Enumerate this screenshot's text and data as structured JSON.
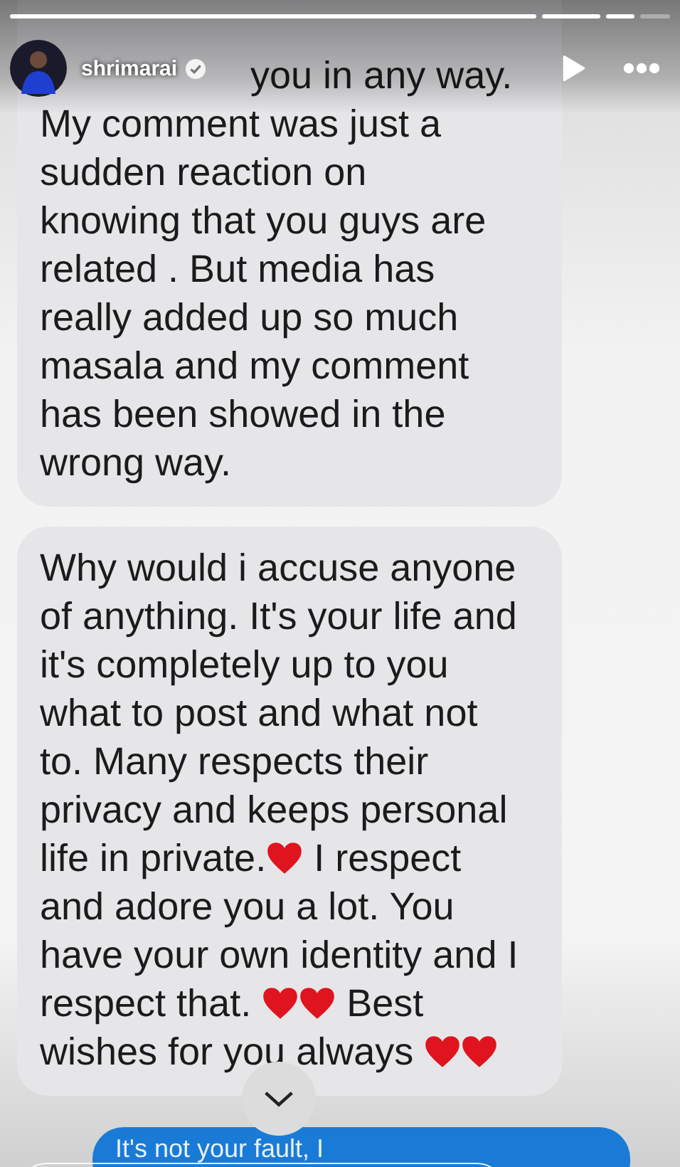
{
  "story_progress": [
    {
      "level": 1
    },
    {
      "level": 1
    },
    {
      "level": 1
    },
    {
      "level": 0
    }
  ],
  "header": {
    "username": "shrimarai",
    "verified": true
  },
  "messages": [
    {
      "kind": "received",
      "top_cut": true,
      "lines": [
        [
          {
            "kind": "text",
            "text": "you in any way."
          }
        ],
        [
          {
            "kind": "text",
            "text": "My comment was just a"
          }
        ],
        [
          {
            "kind": "text",
            "text": "sudden reaction on"
          }
        ],
        [
          {
            "kind": "text",
            "text": "knowing that you guys are"
          }
        ],
        [
          {
            "kind": "text",
            "text": "related . But media has"
          }
        ],
        [
          {
            "kind": "text",
            "text": "really added up so much"
          }
        ],
        [
          {
            "kind": "text",
            "text": "masala and my comment"
          }
        ],
        [
          {
            "kind": "text",
            "text": "has been showed in the"
          }
        ],
        [
          {
            "kind": "text",
            "text": "wrong way."
          }
        ]
      ]
    },
    {
      "kind": "received",
      "lines": [
        [
          {
            "kind": "text",
            "text": "Why would i accuse anyone"
          }
        ],
        [
          {
            "kind": "text",
            "text": "of anything. It's your life and"
          }
        ],
        [
          {
            "kind": "text",
            "text": "it's completely up to you"
          }
        ],
        [
          {
            "kind": "text",
            "text": "what to post and what not"
          }
        ],
        [
          {
            "kind": "text",
            "text": "to. Many respects their"
          }
        ],
        [
          {
            "kind": "text",
            "text": "privacy and keeps personal"
          }
        ],
        [
          {
            "kind": "text",
            "text": "life in private."
          },
          {
            "kind": "heart"
          },
          {
            "kind": "text",
            "text": " I respect"
          }
        ],
        [
          {
            "kind": "text",
            "text": "and adore you a lot. You"
          }
        ],
        [
          {
            "kind": "text",
            "text": "have your own identity and I"
          }
        ],
        [
          {
            "kind": "text",
            "text": "respect that. "
          },
          {
            "kind": "heart"
          },
          {
            "kind": "heart"
          },
          {
            "kind": "text",
            "text": " Best"
          }
        ],
        [
          {
            "kind": "text",
            "text": "wishes for you always "
          },
          {
            "kind": "heart"
          },
          {
            "kind": "heart"
          }
        ]
      ]
    },
    {
      "kind": "sent",
      "lines": [
        [
          {
            "kind": "text",
            "text": "It's not your fault, I"
          }
        ]
      ]
    }
  ]
}
